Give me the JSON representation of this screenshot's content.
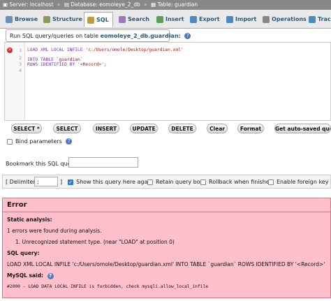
{
  "breadcrumb": {
    "server": "Server: localhost",
    "database": "Database: eomoleye_2_db",
    "table": "Table: guardian",
    "separator": "»"
  },
  "tabs": [
    {
      "label": "Browse",
      "icon": "browse-icon"
    },
    {
      "label": "Structure",
      "icon": "structure-icon"
    },
    {
      "label": "SQL",
      "icon": "sql-icon",
      "active": true
    },
    {
      "label": "Search",
      "icon": "search-icon"
    },
    {
      "label": "Insert",
      "icon": "insert-icon"
    },
    {
      "label": "Export",
      "icon": "export-icon"
    },
    {
      "label": "Import",
      "icon": "import-icon"
    },
    {
      "label": "Operations",
      "icon": "operations-icon"
    },
    {
      "label": "Track",
      "icon": "tracking-icon"
    }
  ],
  "query_panel": {
    "title_prefix": "Run SQL query/queries on table",
    "title_table": "eomoleye_2_db.guardian:"
  },
  "editor": {
    "line_numbers": [
      "1",
      "2",
      "3",
      "4"
    ],
    "line1_kw": "LOAD XML LOCAL INFILE",
    "line1_str": "'c:/Users/omole/Desktop/guardian.xml'",
    "line2_kw": "INTO TABLE",
    "line2_str": "`guardian`",
    "line3_kw": "ROWS IDENTIFIED BY",
    "line3_str": "'<Record>';",
    "line4": ""
  },
  "buttons": {
    "select_star": "SELECT *",
    "select": "SELECT",
    "insert": "INSERT",
    "update": "UPDATE",
    "delete": "DELETE",
    "clear": "Clear",
    "format": "Format",
    "autosaved": "Get auto-saved query"
  },
  "bind_parameters": "Bind parameters",
  "bookmark_label": "Bookmark this SQL query:",
  "options": {
    "delimiter_label": "[ Delimiter",
    "delimiter_value": ";",
    "delimiter_close": "]",
    "show_query": "Show this query here again",
    "retain_box": "Retain query box",
    "rollback": "Rollback when finished",
    "foreign_key": "Enable foreign key checks"
  },
  "error": {
    "title": "Error",
    "static_analysis": "Static analysis:",
    "found": "1 errors were found during analysis.",
    "item": "1. Unrecognized statement type. (near \"LOAD\" at position 0)",
    "sql_query_label": "SQL query:",
    "sql_query": "LOAD XML LOCAL INFILE 'c:/Users/omole/Desktop/guardian.xml' INTO TABLE `guardian` ROWS IDENTIFIED BY '<Record>'",
    "mysql_said": "MySQL said:",
    "message": "#2000 - LOAD DATA LOCAL INFILE is forbidden, check mysqli.allow_local_infile"
  },
  "colors": {
    "accent": "#235a81",
    "error_bg": "#ffc0cb",
    "error_border": "#e07080"
  }
}
